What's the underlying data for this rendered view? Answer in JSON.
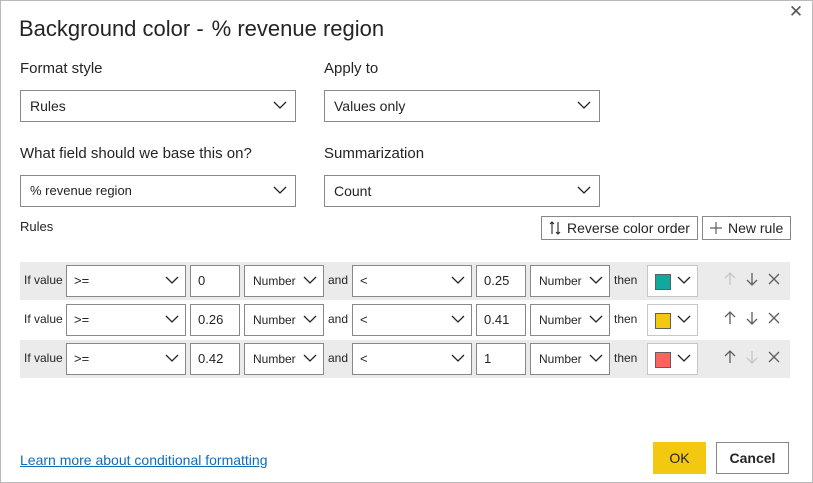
{
  "dialog": {
    "title": "Background color -",
    "field_name": "% revenue region"
  },
  "format_style": {
    "label": "Format style",
    "value": "Rules"
  },
  "apply_to": {
    "label": "Apply to",
    "value": "Values only"
  },
  "base_field": {
    "label": "What field should we base this on?",
    "value": "% revenue region"
  },
  "summarization": {
    "label": "Summarization",
    "value": "Count"
  },
  "rules_section": {
    "label": "Rules",
    "reverse_label": "Reverse color order",
    "new_rule_label": "New rule"
  },
  "rules": [
    {
      "if_label": "If value",
      "op1": ">=",
      "val1": "0",
      "type1": "Number",
      "and_label": "and",
      "op2": "<",
      "val2": "0.25",
      "type2": "Number",
      "then_label": "then",
      "color": "#13a89e"
    },
    {
      "if_label": "If value",
      "op1": ">=",
      "val1": "0.26",
      "type1": "Number",
      "and_label": "and",
      "op2": "<",
      "val2": "0.41",
      "type2": "Number",
      "then_label": "then",
      "color": "#f2c811"
    },
    {
      "if_label": "If value",
      "op1": ">=",
      "val1": "0.42",
      "type1": "Number",
      "and_label": "and",
      "op2": "<",
      "val2": "1",
      "type2": "Number",
      "then_label": "then",
      "color": "#fd625e"
    }
  ],
  "footer": {
    "learn_more": "Learn more about conditional formatting",
    "ok_label": "OK",
    "cancel_label": "Cancel"
  }
}
